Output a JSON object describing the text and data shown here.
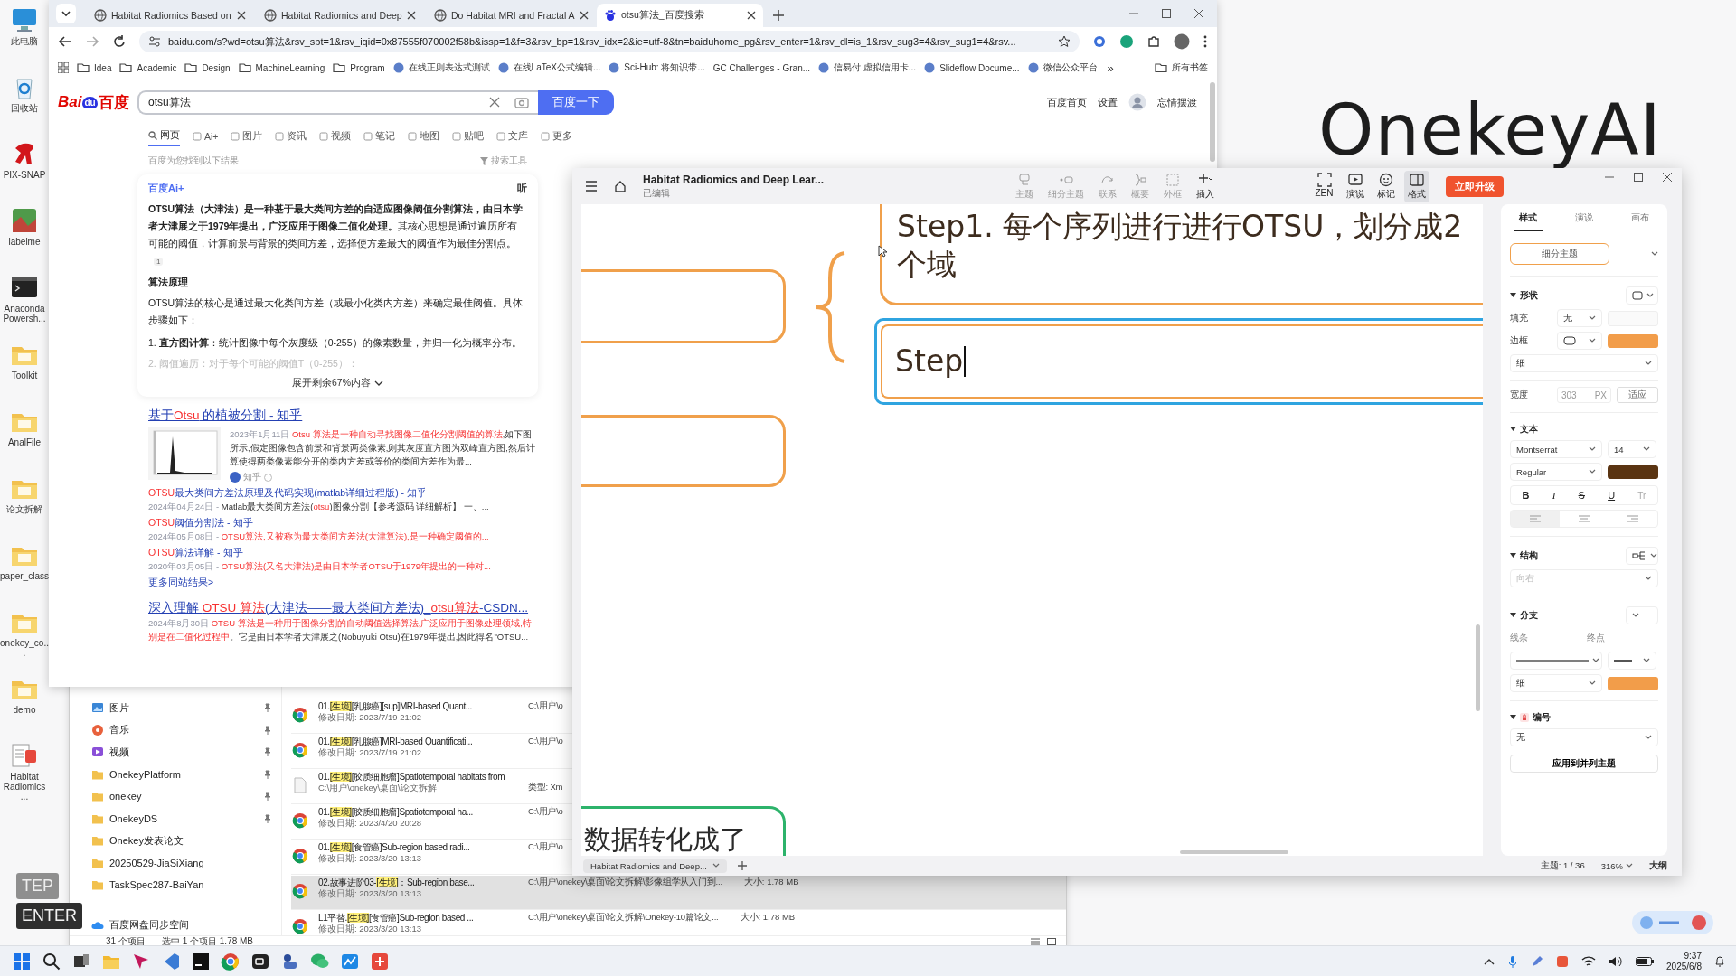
{
  "desktop": {
    "wallpaper_text": "OnekeyAI",
    "icons": [
      {
        "label": "此电脑",
        "kind": "computer"
      },
      {
        "label": "回收站",
        "kind": "recycle"
      },
      {
        "label": "PIX-SNAP",
        "kind": "figure_app"
      },
      {
        "label": "labelme",
        "kind": "image_app"
      },
      {
        "label": "Anaconda Powersh...",
        "kind": "terminal"
      },
      {
        "label": "Toolkit",
        "kind": "folder"
      },
      {
        "label": "AnalFile",
        "kind": "folder"
      },
      {
        "label": "论文拆解",
        "kind": "folder"
      },
      {
        "label": "paper_class",
        "kind": "folder"
      },
      {
        "label": "onekey_co...",
        "kind": "folder"
      },
      {
        "label": "demo",
        "kind": "folder"
      },
      {
        "label": "Habitat Radiomics ...",
        "kind": "document"
      }
    ],
    "keys": [
      "TEP",
      "ENTER"
    ]
  },
  "browser": {
    "tabs": [
      {
        "title": "Habitat Radiomics Based on",
        "selected": false
      },
      {
        "title": "Habitat Radiomics and Deep",
        "selected": false
      },
      {
        "title": "Do Habitat MRI and Fractal A",
        "selected": false
      },
      {
        "title": "otsu算法_百度搜索",
        "selected": true
      }
    ],
    "url": "baidu.com/s?wd=otsu算法&rsv_spt=1&rsv_iqid=0x87555f070002f58b&issp=1&f=3&rsv_bp=1&rsv_idx=2&ie=utf-8&tn=baiduhome_pg&rsv_enter=1&rsv_dl=is_1&rsv_sug3=4&rsv_sug1=4&rsv...",
    "bookmarks": [
      {
        "label": "Idea",
        "kind": "folder"
      },
      {
        "label": "Academic",
        "kind": "folder"
      },
      {
        "label": "Design",
        "kind": "folder"
      },
      {
        "label": "MachineLearning",
        "kind": "folder"
      },
      {
        "label": "Program",
        "kind": "folder"
      },
      {
        "label": "在线正则表达式测试",
        "kind": "site"
      },
      {
        "label": "在线LaTeX公式编辑...",
        "kind": "site"
      },
      {
        "label": "Sci-Hub: 将知识带...",
        "kind": "site"
      },
      {
        "label": "GC Challenges - Gran...",
        "kind": "plain"
      },
      {
        "label": "信易付 虚拟信用卡...",
        "kind": "site"
      },
      {
        "label": "Slideflow Docume...",
        "kind": "site"
      },
      {
        "label": "微信公众平台",
        "kind": "site"
      }
    ],
    "bookmarks_more": "»",
    "all_bookmarks": "所有书签",
    "page": {
      "logo": {
        "first": "Bai",
        "paw": "du",
        "last": "百度"
      },
      "query": "otsu算法",
      "search_button": "百度一下",
      "header_links": [
        "百度首页",
        "设置"
      ],
      "user": "忘情摆渡",
      "verticals": [
        {
          "label": "网页",
          "selected": true
        },
        {
          "label": "Ai+",
          "selected": false
        },
        {
          "label": "图片",
          "selected": false
        },
        {
          "label": "资讯",
          "selected": false
        },
        {
          "label": "视频",
          "selected": false
        },
        {
          "label": "笔记",
          "selected": false
        },
        {
          "label": "地图",
          "selected": false
        },
        {
          "label": "贴吧",
          "selected": false
        },
        {
          "label": "文库",
          "selected": false
        },
        {
          "label": "更多",
          "selected": false
        }
      ],
      "result_note": "百度为您找到以下结果",
      "tools": "搜索工具",
      "ai_card": {
        "brand": "百度Ai+",
        "listen": "听",
        "summary": "**OTSU算法（大津法）是一种基于最大类间方差的自适应图像阈值分割算法，由日本学者大津展之于1979年提出，广泛应用于图像二值化处理。**其核心思想是通过遍历所有可能的阈值，计算前景与背景的类间方差，选择使方差最大的阈值作为最佳分割点。",
        "citation": "1",
        "heading": "算法原理",
        "intro": "OTSU算法的核心是通过最大化类间方差（或最小化类内方差）来确定最佳阈值。具体步骤如下：",
        "steps": [
          {
            "text": "1. **直方图计算**：统计图像中每个灰度级（0-255）的像素数量，并归一化为概率分布。",
            "faded": false
          },
          {
            "text": "2. 阈值遍历：对于每个可能的阈值T（0-255）：",
            "faded": true
          }
        ],
        "expand": "展开剩余67%内容"
      },
      "results": [
        {
          "title": [
            {
              "text": "基于",
              "hit": false
            },
            {
              "text": "Otsu",
              "hit": true
            },
            {
              "text": " 的植被分割 - 知乎",
              "hit": false
            }
          ],
          "date": "2023年1月11日 ",
          "snippet": [
            {
              "text": "Otsu 算法是一种自动寻找图像二值化分割阈值的算法",
              "hit": true
            },
            {
              "text": ",如下图所示,假定图像包含前景和背景两类像素,则其灰度直方图为双峰直方图,然后计算使得两类像素能分开的类内方差或等价的类间方差作为最...",
              "hit": false
            }
          ],
          "source": "知乎",
          "subresults": [
            {
              "title": [
                {
                  "text": "OTSU",
                  "hit": true
                },
                {
                  "text": "最大类间方差法原理及代码实现(matlab详细过程版) - 知乎",
                  "hit": false
                }
              ],
              "date": "2024年04月24日 - ",
              "snippet": [
                {
                  "text": "Matlab最大类间方差法(",
                  "hit": false
                },
                {
                  "text": "otsu",
                  "hit": true
                },
                {
                  "text": ")图像分割【参考源码 详细解析】 一、...",
                  "hit": false
                }
              ]
            },
            {
              "title": [
                {
                  "text": "OTSU",
                  "hit": true
                },
                {
                  "text": "阈值分割法 - 知乎",
                  "hit": false
                }
              ],
              "date": "2024年05月08日 - ",
              "snippet": [
                {
                  "text": "OTSU算法,又被称为最大类间方差法(大津算法),是一种确定阈值的...",
                  "hit": true
                }
              ]
            },
            {
              "title": [
                {
                  "text": "OTSU",
                  "hit": true
                },
                {
                  "text": "算法详解 - 知乎",
                  "hit": false
                }
              ],
              "date": "2020年03月05日 - ",
              "snippet": [
                {
                  "text": "OTSU算法(又名大津法)是由日本学者OTSU于1979年提出的一种对...",
                  "hit": true
                }
              ]
            }
          ],
          "more": "更多同站结果>"
        },
        {
          "title": [
            {
              "text": "深入理解 ",
              "hit": false
            },
            {
              "text": "OTSU 算法",
              "hit": true
            },
            {
              "text": "(大津法——最大类间方差法)_",
              "hit": false
            },
            {
              "text": "otsu算法",
              "hit": true
            },
            {
              "text": "-CSDN...",
              "hit": false
            }
          ],
          "date": "2024年8月30日 ",
          "snippet": [
            {
              "text": "OTSU 算法是一种用于图像分割的自动阈值选择算法,广泛应用于图像处理领域,特别是在二值化过程中",
              "hit": true
            },
            {
              "text": "。它是由日本学者大津展之(Nobuyuki Otsu)在1979年提出,因此得名\"OTSU...",
              "hit": false
            }
          ]
        }
      ]
    }
  },
  "explorer": {
    "nav": [
      {
        "label": "图片",
        "kind": "pictures",
        "pinned": true
      },
      {
        "label": "音乐",
        "kind": "music",
        "pinned": true
      },
      {
        "label": "视频",
        "kind": "videos",
        "pinned": true
      },
      {
        "label": "OnekeyPlatform",
        "kind": "folder",
        "pinned": true
      },
      {
        "label": "onekey",
        "kind": "folder",
        "pinned": true
      },
      {
        "label": "OnekeyDS",
        "kind": "folder",
        "pinned": true
      },
      {
        "label": "Onekey发表论文",
        "kind": "folder",
        "pinned": false
      },
      {
        "label": "20250529-JiaSiXiang",
        "kind": "folder",
        "pinned": false
      },
      {
        "label": "TaskSpec287-BaiYan",
        "kind": "folder",
        "pinned": false
      },
      {
        "label": "百度网盘同步空间",
        "kind": "cloud",
        "pinned": false
      }
    ],
    "rows": [
      {
        "kind": "web",
        "selected": false,
        "name": [
          {
            "text": "01.",
            "hit": false
          },
          {
            "text": "[生境]",
            "hit": true
          },
          {
            "text": "[乳腺癌][sup]MRI-based Quant...",
            "hit": false
          }
        ],
        "detail": "修改日期: 2023/7/19 21:02",
        "path": "C:\\用户\\o"
      },
      {
        "kind": "web",
        "selected": false,
        "name": [
          {
            "text": "01.",
            "hit": false
          },
          {
            "text": "[生境]",
            "hit": true
          },
          {
            "text": "[乳腺癌]MRI-based Quantificati...",
            "hit": false
          }
        ],
        "detail": "修改日期: 2023/7/19 21:02",
        "path": "C:\\用户\\o"
      },
      {
        "kind": "xml",
        "selected": false,
        "name": [
          {
            "text": "01.",
            "hit": false
          },
          {
            "text": "[生境]",
            "hit": true
          },
          {
            "text": "[胶质细胞瘤]Spatiotemporal habitats from",
            "hit": false
          }
        ],
        "detail": "C:\\用户\\onekey\\桌面\\论文拆解",
        "path": "类型: Xm"
      },
      {
        "kind": "web",
        "selected": false,
        "name": [
          {
            "text": "01.",
            "hit": false
          },
          {
            "text": "[生境]",
            "hit": true
          },
          {
            "text": "[胶质细胞瘤]Spatiotemporal ha...",
            "hit": false
          }
        ],
        "detail": "修改日期: 2023/4/20 20:28",
        "path": "C:\\用户\\o"
      },
      {
        "kind": "web",
        "selected": false,
        "name": [
          {
            "text": "01.",
            "hit": false
          },
          {
            "text": "[生境]",
            "hit": true
          },
          {
            "text": "[食管癌]Sub-region based radi...",
            "hit": false
          }
        ],
        "detail": "修改日期: 2023/3/20 13:13",
        "path": "C:\\用户\\o"
      },
      {
        "kind": "web",
        "selected": true,
        "name": [
          {
            "text": "02.故事进阶03-",
            "hit": false
          },
          {
            "text": "[生境]",
            "hit": true
          },
          {
            "text": "：Sub-region base...",
            "hit": false
          }
        ],
        "detail": "修改日期: 2023/3/20 13:13",
        "path": "C:\\用户\\onekey\\桌面\\论文拆解\\影像组学从入门到...",
        "size": "大小: 1.78 MB"
      },
      {
        "kind": "web",
        "selected": false,
        "name": [
          {
            "text": "L1平替.",
            "hit": false
          },
          {
            "text": "[生境]",
            "hit": true
          },
          {
            "text": "[食管癌]Sub-region based ...",
            "hit": false
          }
        ],
        "detail": "修改日期: 2023/3/20 13:13",
        "path": "C:\\用户\\onekey\\桌面\\论文拆解\\Onekey-10篇论文...",
        "size": "大小: 1.78 MB"
      }
    ],
    "status": [
      "31 个项目",
      "选中 1 个项目  1.78 MB"
    ]
  },
  "mindmap": {
    "title": "Habitat Radiomics and Deep Lear...",
    "subtitle": "已编辑",
    "tools": [
      {
        "label": "主题",
        "kind": "topic",
        "disabled": true
      },
      {
        "label": "细分主题",
        "kind": "subtopic",
        "disabled": true
      },
      {
        "label": "联系",
        "kind": "relation",
        "disabled": true
      },
      {
        "label": "概要",
        "kind": "summary",
        "disabled": true
      },
      {
        "label": "外框",
        "kind": "boundary",
        "disabled": true
      },
      {
        "label": "插入",
        "kind": "insert",
        "disabled": false
      }
    ],
    "views": [
      {
        "label": "ZEN",
        "kind": "zen",
        "selected": false
      },
      {
        "label": "演说",
        "kind": "present",
        "selected": false
      },
      {
        "label": "标记",
        "kind": "marker",
        "selected": false
      },
      {
        "label": "格式",
        "kind": "format",
        "selected": true
      }
    ],
    "upgrade": "立即升级",
    "nodes": [
      {
        "color": "#f0a04b"
      },
      {
        "color": "#f0a04b"
      },
      {
        "color": "#2db36b",
        "text": "数据转化成了"
      }
    ],
    "topic": "Step1. 每个序列进行进行OTSU，划分成2个域",
    "editing": {
      "text": "Step",
      "color": "#2fa4e0"
    },
    "doc_tab": "Habitat Radiomics and Deep...",
    "status": {
      "topics": "主题: 1 / 36",
      "zoom": "316%",
      "outline": "大纲"
    },
    "panel": {
      "tabs": [
        {
          "label": "样式",
          "selected": true
        },
        {
          "label": "演说",
          "selected": false
        },
        {
          "label": "画布",
          "selected": false
        }
      ],
      "preset": "细分主题",
      "shape": {
        "title": "形状",
        "fill_label": "填充",
        "fill_value": "无",
        "border_label": "边框",
        "border_swatch": {
          "color": "#f29d4a"
        },
        "weight": "细",
        "width_label": "宽度",
        "width_value": "303",
        "width_unit": "PX",
        "fit": "适应"
      },
      "text": {
        "title": "文本",
        "font": "Montserrat",
        "size": "14",
        "style": "Regular",
        "color": "#5a3412",
        "formats": [
          {
            "label": "B",
            "kind": "bold"
          },
          {
            "label": "I",
            "kind": "italic"
          },
          {
            "label": "S",
            "kind": "strike"
          },
          {
            "label": "U",
            "kind": "underline"
          },
          {
            "label": "Tr",
            "kind": "case"
          }
        ],
        "aligns": [
          {
            "kind": "left",
            "selected": true
          },
          {
            "kind": "center",
            "selected": false
          },
          {
            "kind": "right",
            "selected": false
          }
        ]
      },
      "structure": {
        "title": "结构",
        "direction": "向右"
      },
      "branch": {
        "title": "分支",
        "line_label": "线条",
        "end_label": "终点",
        "weight": "细",
        "color": "#f29d4a"
      },
      "numbering": {
        "title": "编号",
        "value": "无"
      },
      "apply": "应用到并列主题"
    }
  },
  "taskbar": {
    "time": "9:37",
    "date": "2025/6/8"
  }
}
